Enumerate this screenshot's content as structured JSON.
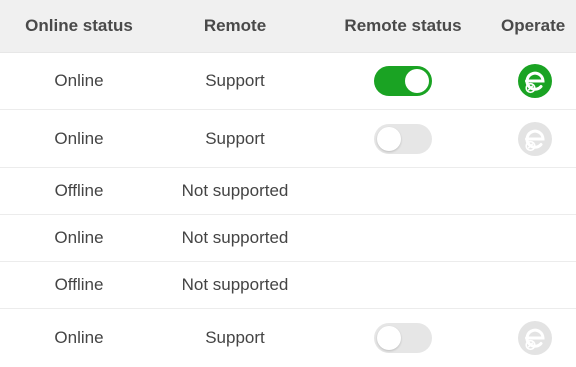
{
  "columns": {
    "online_status": "Online status",
    "remote": "Remote",
    "remote_status": "Remote status",
    "operate": "Operate"
  },
  "rows": [
    {
      "online": "Online",
      "remote": "Support",
      "toggle": "on",
      "operate": "active"
    },
    {
      "online": "Online",
      "remote": "Support",
      "toggle": "off",
      "operate": "disabled"
    },
    {
      "online": "Offline",
      "remote": "Not supported",
      "toggle": null,
      "operate": null
    },
    {
      "online": "Online",
      "remote": "Not supported",
      "toggle": null,
      "operate": null
    },
    {
      "online": "Offline",
      "remote": "Not supported",
      "toggle": null,
      "operate": null
    },
    {
      "online": "Online",
      "remote": "Support",
      "toggle": "off",
      "operate": "disabled"
    }
  ],
  "icons": {
    "operate": "remote-control-icon"
  },
  "colors": {
    "toggle_on": "#1aa323",
    "toggle_off": "#e6e6e6",
    "operate_active": "#1aa323",
    "operate_disabled": "#e3e3e3",
    "header_bg": "#f0f0f0"
  }
}
